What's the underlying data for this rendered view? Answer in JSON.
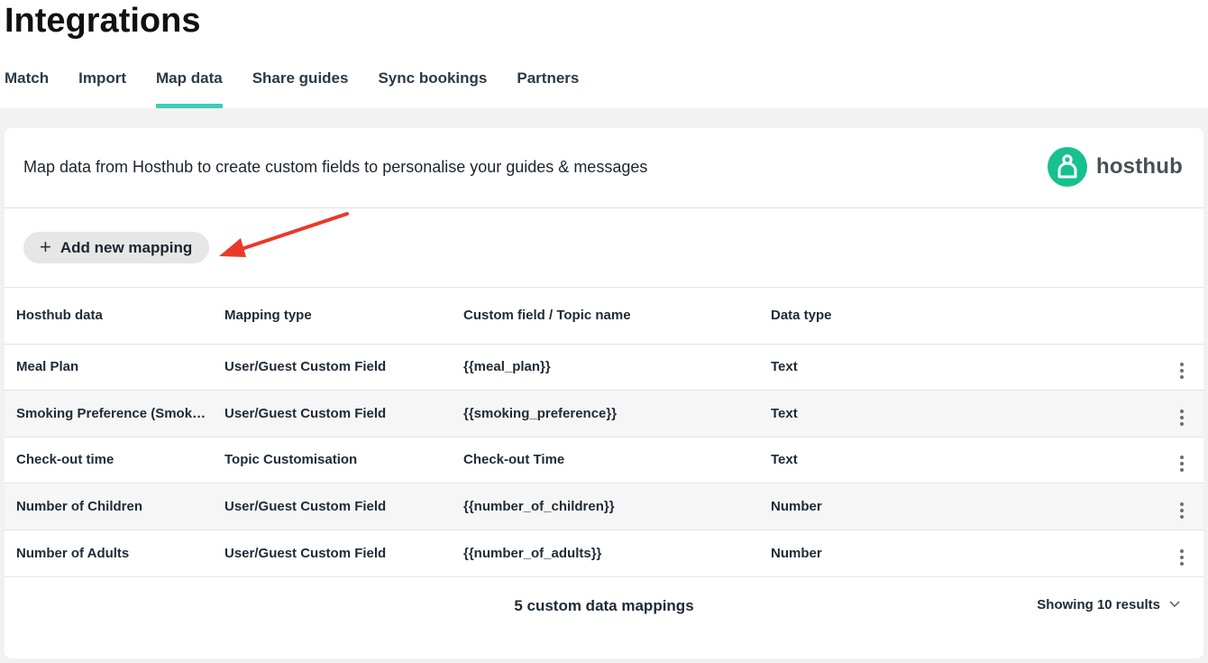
{
  "page": {
    "title": "Integrations"
  },
  "tabs": [
    {
      "label": "Match"
    },
    {
      "label": "Import"
    },
    {
      "label": "Map data",
      "active": true
    },
    {
      "label": "Share guides"
    },
    {
      "label": "Sync bookings"
    },
    {
      "label": "Partners"
    }
  ],
  "card": {
    "description": "Map data from Hosthub to create custom fields to personalise your guides & messages",
    "logo_text": "hosthub"
  },
  "toolbar": {
    "add_label": "Add new mapping"
  },
  "table": {
    "headers": [
      "Hosthub data",
      "Mapping type",
      "Custom field / Topic name",
      "Data type"
    ],
    "rows": [
      [
        "Meal Plan",
        "User/Guest Custom Field",
        "{{meal_plan}}",
        "Text"
      ],
      [
        "Smoking Preference (Smok…",
        "User/Guest Custom Field",
        "{{smoking_preference}}",
        "Text"
      ],
      [
        "Check-out time",
        "Topic Customisation",
        "Check-out Time",
        "Text"
      ],
      [
        "Number of Children",
        "User/Guest Custom Field",
        "{{number_of_children}}",
        "Number"
      ],
      [
        "Number of Adults",
        "User/Guest Custom Field",
        "{{number_of_adults}}",
        "Number"
      ]
    ]
  },
  "footer": {
    "count_text": "5 custom data mappings",
    "showing_text": "Showing 10 results"
  },
  "colors": {
    "accent": "#3ecdb5",
    "logo": "#17c08f",
    "annotation_arrow": "#e8392b"
  }
}
